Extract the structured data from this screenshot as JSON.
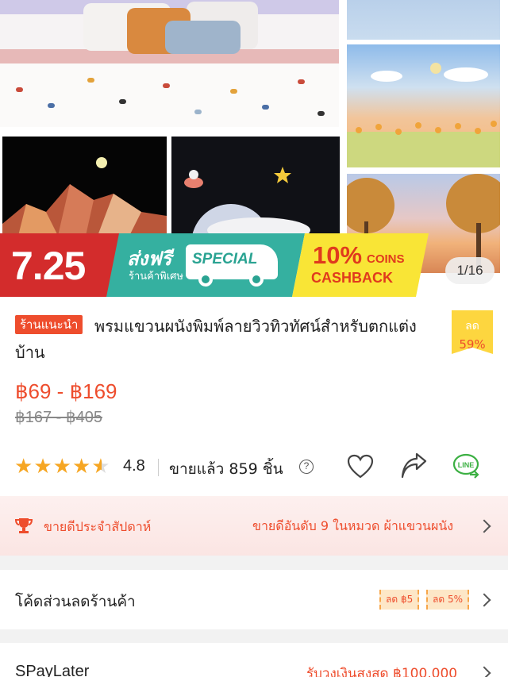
{
  "gallery": {
    "counter": "1/16",
    "promo": {
      "date": "7.25",
      "free_shipping": "ส่งฟรี",
      "special_shop": "ร้านค้าพิเศษ",
      "special": "SPECIAL",
      "coins_percent": "10%",
      "coins": "COINS",
      "cashback": "CASHBACK"
    }
  },
  "product": {
    "tag": "ร้านแนะนำ",
    "title": "พรมแขวนผนังพิมพ์ลายวิวทิวทัศน์สำหรับตกแต่งบ้าน",
    "discount_label": "ลด",
    "discount_value": "59%",
    "price": "฿69 - ฿169",
    "original_price": "฿167 - ฿405",
    "rating": "4.8",
    "rating_value": 4.8,
    "sold": "ขายแล้ว 859 ชิ้น",
    "help": "?"
  },
  "bestseller": {
    "label": "ขายดีประจำสัปดาห์",
    "rank_text": "ขายดีอันดับ 9 ในหมวด ผ้าแขวนผนัง"
  },
  "voucher": {
    "label": "โค้ดส่วนลดร้านค้า",
    "tags": [
      "ลด ฿5",
      "ลด 5%"
    ]
  },
  "spaylater": {
    "label": "SPayLater",
    "value": "รับวงเงินสูงสุด ฿100,000"
  },
  "icons": {
    "like": "heart-icon",
    "share": "share-icon",
    "line": "line-icon",
    "trophy": "trophy-icon"
  },
  "colors": {
    "accent": "#ee4d2d",
    "star": "#f6a623",
    "promo_red": "#d32c2c",
    "promo_teal": "#35b0a0",
    "promo_yellow": "#f9e536",
    "line_green": "#3cb043"
  }
}
